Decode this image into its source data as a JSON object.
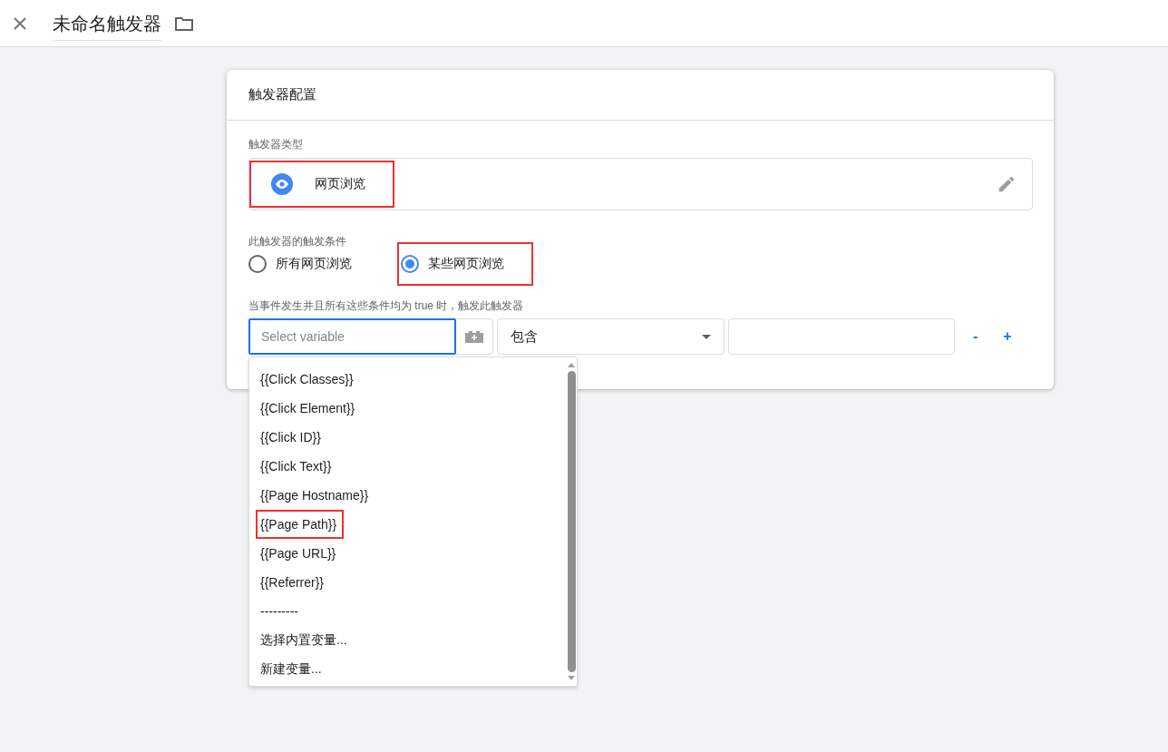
{
  "header": {
    "title": "未命名触发器"
  },
  "card": {
    "title": "触发器配置",
    "trigger_type": {
      "label": "触发器类型",
      "name": "网页浏览",
      "highlighted": true
    },
    "condition": {
      "label": "此触发器的触发条件",
      "options": [
        {
          "label": "所有网页浏览",
          "selected": false,
          "highlighted": false
        },
        {
          "label": "某些网页浏览",
          "selected": true,
          "highlighted": true
        }
      ]
    },
    "filter": {
      "label": "当事件发生并且所有这些条件均为 true 时，触发此触发器",
      "variable_placeholder": "Select variable",
      "operator": "包含",
      "remove": "-",
      "add": "+"
    }
  },
  "dropdown": {
    "items": [
      {
        "label": "{{Click Classes}}",
        "highlighted": false
      },
      {
        "label": "{{Click Element}}",
        "highlighted": false
      },
      {
        "label": "{{Click ID}}",
        "highlighted": false
      },
      {
        "label": "{{Click Text}}",
        "highlighted": false
      },
      {
        "label": "{{Page Hostname}}",
        "highlighted": false
      },
      {
        "label": "{{Page Path}}",
        "highlighted": true
      },
      {
        "label": "{{Page URL}}",
        "highlighted": false
      },
      {
        "label": "{{Referrer}}",
        "highlighted": false
      },
      {
        "label": "---------",
        "highlighted": false
      },
      {
        "label": "选择内置变量...",
        "highlighted": false
      },
      {
        "label": "新建变量...",
        "highlighted": false
      }
    ]
  }
}
